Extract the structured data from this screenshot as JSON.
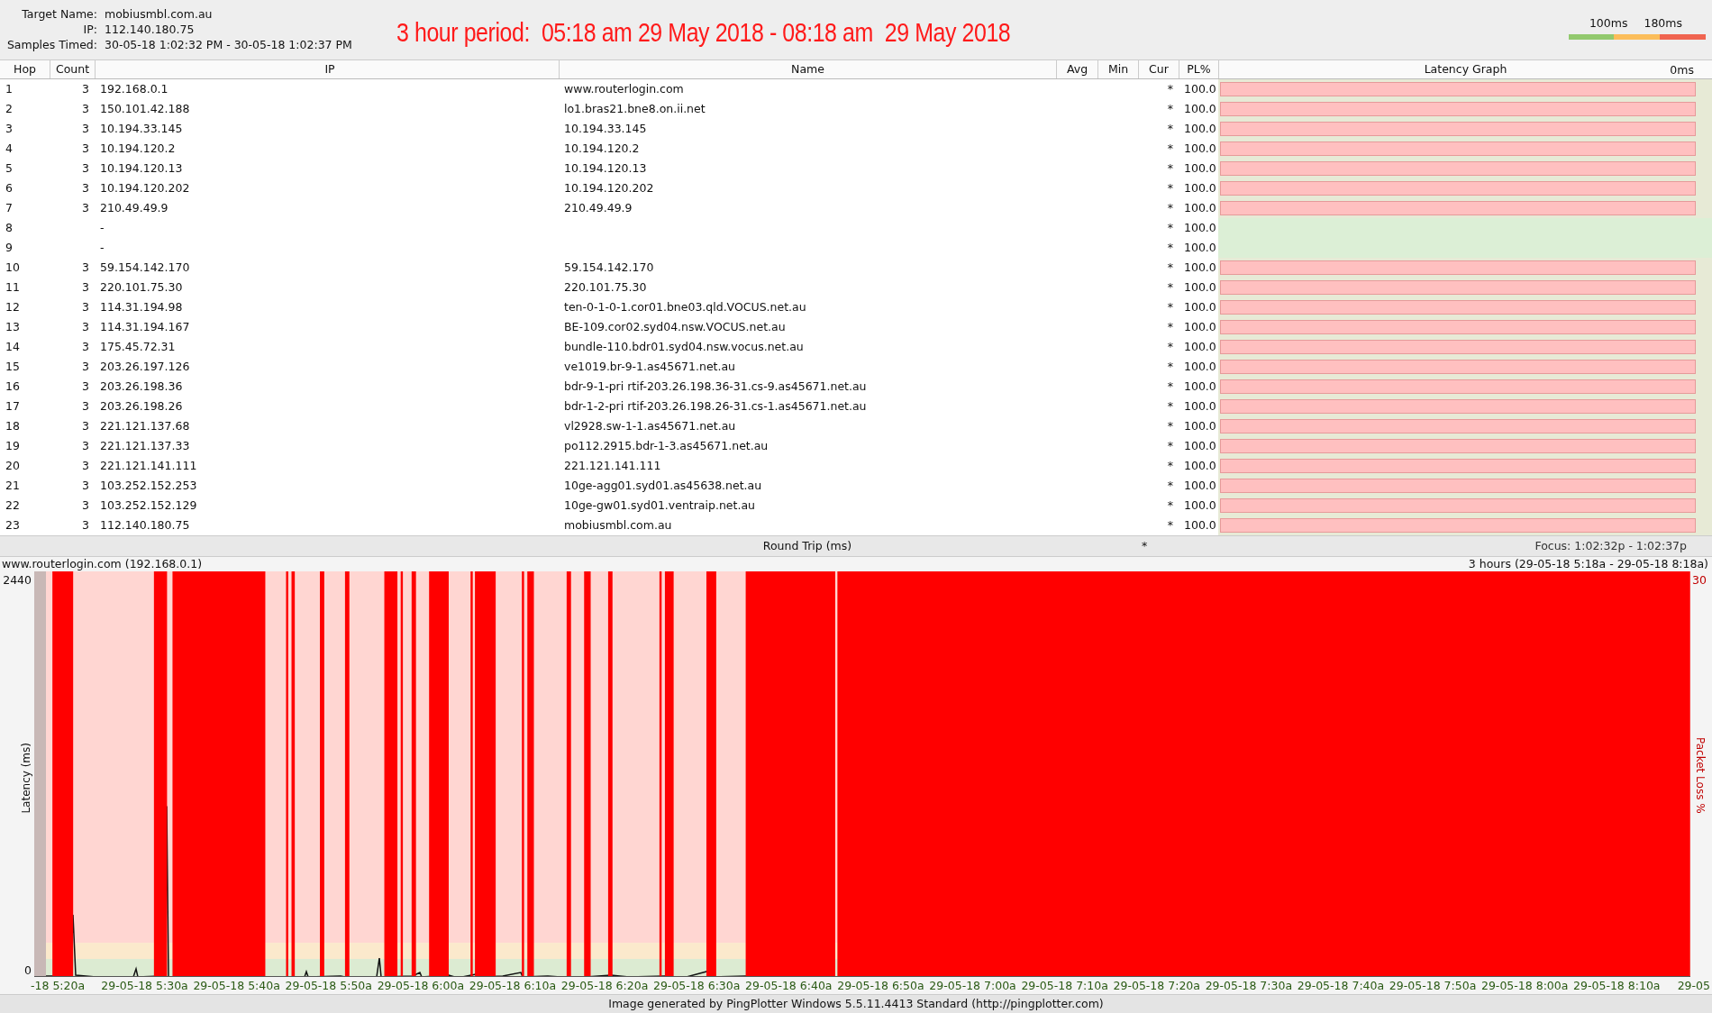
{
  "info": [
    {
      "label": "Target Name:",
      "value": "mobiusmbl.com.au"
    },
    {
      "label": "IP:",
      "value": "112.140.180.75"
    },
    {
      "label": "Samples Timed:",
      "value": "30-05-18 1:02:32 PM - 30-05-18 1:02:37 PM"
    }
  ],
  "period_title": "3 hour period:  05:18 am 29 May 2018 - 08:18 am  29 May 2018",
  "legend": {
    "labels": [
      "100ms",
      "180ms"
    ]
  },
  "table": {
    "columns": [
      "Hop",
      "Count",
      "IP",
      "Name",
      "Avg",
      "Min",
      "Cur",
      "PL%",
      "Latency Graph"
    ],
    "graph_scale": "0ms",
    "rows": [
      {
        "hop": "1",
        "count": "3",
        "ip": "192.168.0.1",
        "name": "www.routerlogin.com",
        "cur": "*",
        "pl": "100.0",
        "loss_bar": true
      },
      {
        "hop": "2",
        "count": "3",
        "ip": "150.101.42.188",
        "name": "lo1.bras21.bne8.on.ii.net",
        "cur": "*",
        "pl": "100.0",
        "loss_bar": true
      },
      {
        "hop": "3",
        "count": "3",
        "ip": "10.194.33.145",
        "name": "10.194.33.145",
        "cur": "*",
        "pl": "100.0",
        "loss_bar": true
      },
      {
        "hop": "4",
        "count": "3",
        "ip": "10.194.120.2",
        "name": "10.194.120.2",
        "cur": "*",
        "pl": "100.0",
        "loss_bar": true
      },
      {
        "hop": "5",
        "count": "3",
        "ip": "10.194.120.13",
        "name": "10.194.120.13",
        "cur": "*",
        "pl": "100.0",
        "loss_bar": true
      },
      {
        "hop": "6",
        "count": "3",
        "ip": "10.194.120.202",
        "name": "10.194.120.202",
        "cur": "*",
        "pl": "100.0",
        "loss_bar": true
      },
      {
        "hop": "7",
        "count": "3",
        "ip": "210.49.49.9",
        "name": "210.49.49.9",
        "cur": "*",
        "pl": "100.0",
        "loss_bar": true
      },
      {
        "hop": "8",
        "ip": "-",
        "cur": "*",
        "pl": "100.0",
        "loss_bar": false
      },
      {
        "hop": "9",
        "ip": "-",
        "cur": "*",
        "pl": "100.0",
        "loss_bar": false
      },
      {
        "hop": "10",
        "count": "3",
        "ip": "59.154.142.170",
        "name": "59.154.142.170",
        "cur": "*",
        "pl": "100.0",
        "loss_bar": true
      },
      {
        "hop": "11",
        "count": "3",
        "ip": "220.101.75.30",
        "name": "220.101.75.30",
        "cur": "*",
        "pl": "100.0",
        "loss_bar": true
      },
      {
        "hop": "12",
        "count": "3",
        "ip": "114.31.194.98",
        "name": "ten-0-1-0-1.cor01.bne03.qld.VOCUS.net.au",
        "cur": "*",
        "pl": "100.0",
        "loss_bar": true
      },
      {
        "hop": "13",
        "count": "3",
        "ip": "114.31.194.167",
        "name": "BE-109.cor02.syd04.nsw.VOCUS.net.au",
        "cur": "*",
        "pl": "100.0",
        "loss_bar": true
      },
      {
        "hop": "14",
        "count": "3",
        "ip": "175.45.72.31",
        "name": "bundle-110.bdr01.syd04.nsw.vocus.net.au",
        "cur": "*",
        "pl": "100.0",
        "loss_bar": true
      },
      {
        "hop": "15",
        "count": "3",
        "ip": "203.26.197.126",
        "name": "ve1019.br-9-1.as45671.net.au",
        "cur": "*",
        "pl": "100.0",
        "loss_bar": true
      },
      {
        "hop": "16",
        "count": "3",
        "ip": "203.26.198.36",
        "name": "bdr-9-1-pri rtif-203.26.198.36-31.cs-9.as45671.net.au",
        "cur": "*",
        "pl": "100.0",
        "loss_bar": true
      },
      {
        "hop": "17",
        "count": "3",
        "ip": "203.26.198.26",
        "name": "bdr-1-2-pri rtif-203.26.198.26-31.cs-1.as45671.net.au",
        "cur": "*",
        "pl": "100.0",
        "loss_bar": true
      },
      {
        "hop": "18",
        "count": "3",
        "ip": "221.121.137.68",
        "name": "vl2928.sw-1-1.as45671.net.au",
        "cur": "*",
        "pl": "100.0",
        "loss_bar": true
      },
      {
        "hop": "19",
        "count": "3",
        "ip": "221.121.137.33",
        "name": "po112.2915.bdr-1-3.as45671.net.au",
        "cur": "*",
        "pl": "100.0",
        "loss_bar": true
      },
      {
        "hop": "20",
        "count": "3",
        "ip": "221.121.141.111",
        "name": "221.121.141.111",
        "cur": "*",
        "pl": "100.0",
        "loss_bar": true
      },
      {
        "hop": "21",
        "count": "3",
        "ip": "103.252.152.253",
        "name": "10ge-agg01.syd01.as45638.net.au",
        "cur": "*",
        "pl": "100.0",
        "loss_bar": true
      },
      {
        "hop": "22",
        "count": "3",
        "ip": "103.252.152.129",
        "name": "10ge-gw01.syd01.ventraip.net.au",
        "cur": "*",
        "pl": "100.0",
        "loss_bar": true
      },
      {
        "hop": "23",
        "count": "3",
        "ip": "112.140.180.75",
        "name": "mobiusmbl.com.au",
        "cur": "*",
        "pl": "100.0",
        "loss_bar": true
      }
    ]
  },
  "summary": {
    "label": "Round Trip (ms)",
    "cur": "*",
    "focus": "Focus: 1:02:32p - 1:02:37p"
  },
  "chart": {
    "title": "www.routerlogin.com (192.168.0.1)",
    "range": "3 hours (29-05-18 5:18a - 29-05-18 8:18a)",
    "y_max": "2440",
    "y_min": "0",
    "y_label": "Latency (ms)",
    "loss_max": "30",
    "loss_label": "Packet Loss %",
    "x_ticks": [
      "-18 5:20a",
      "29-05-18 5:30a",
      "29-05-18 5:40a",
      "29-05-18 5:50a",
      "29-05-18 6:00a",
      "29-05-18 6:10a",
      "29-05-18 6:20a",
      "29-05-18 6:30a",
      "29-05-18 6:40a",
      "29-05-18 6:50a",
      "29-05-18 7:00a",
      "29-05-18 7:10a",
      "29-05-18 7:20a",
      "29-05-18 7:30a",
      "29-05-18 7:40a",
      "29-05-18 7:50a",
      "29-05-18 8:00a",
      "29-05-18 8:10a",
      "29-05"
    ]
  },
  "footer": "Image generated by PingPlotter Windows 5.5.11.4413 Standard (http://pingplotter.com)"
}
